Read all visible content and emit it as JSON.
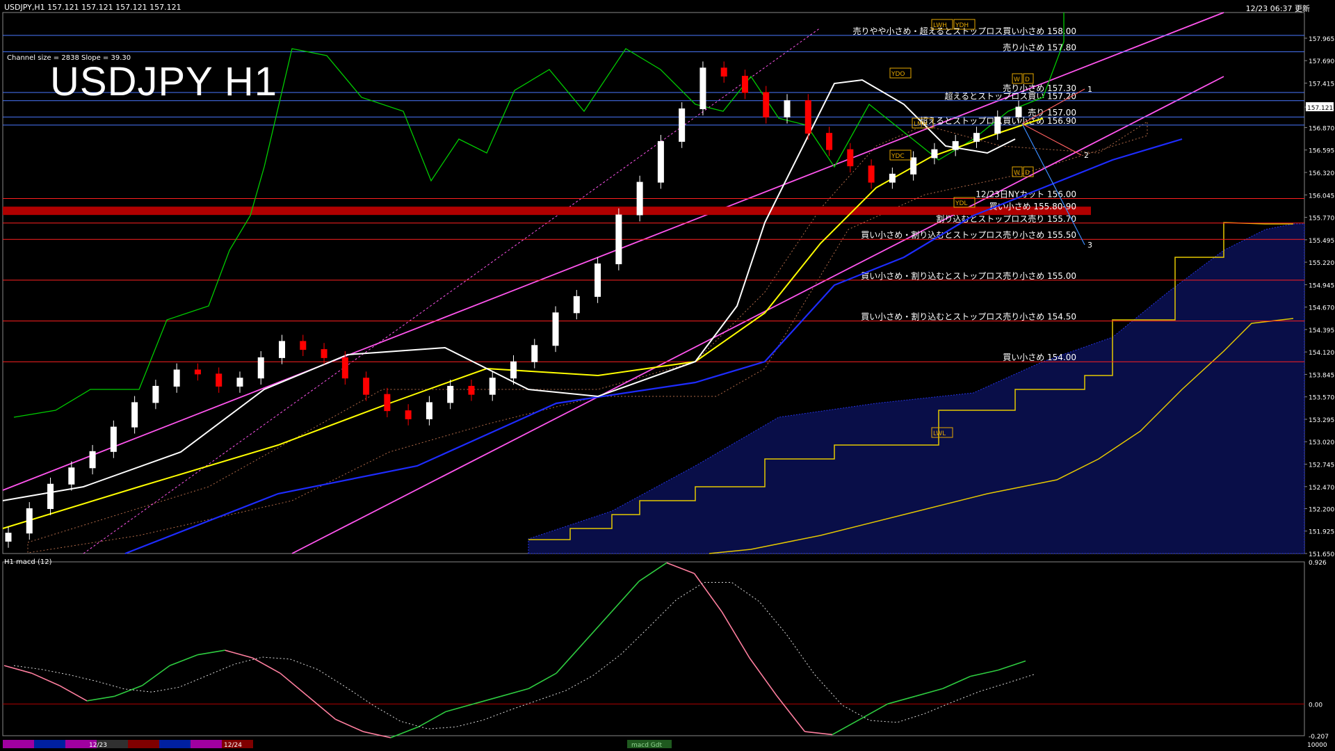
{
  "header": {
    "symbol_info": "USDJPY,H1  157.121 157.121 157.121 157.121",
    "clock": "12/23 06:37 更新",
    "big_symbol": "USDJPY H1",
    "channel_info": "Channel size = 2838 Slope = 39.30",
    "sub_label": "H1  macd (12)"
  },
  "chart_data": [
    {
      "type": "line",
      "title": "USDJPY H1",
      "ylim": [
        151.65,
        158.28
      ],
      "y_ticks": [
        "157.965",
        "157.690",
        "157.415",
        "157.121",
        "156.870",
        "156.595",
        "156.320",
        "156.045",
        "155.770",
        "155.495",
        "155.220",
        "154.945",
        "154.670",
        "154.395",
        "154.120",
        "153.845",
        "153.570",
        "153.295",
        "153.020",
        "152.745",
        "152.470",
        "152.200",
        "151.925",
        "151.650"
      ],
      "current_price": 157.121,
      "price_series": [
        151.9,
        152.2,
        152.5,
        152.7,
        152.9,
        153.2,
        153.5,
        153.7,
        153.9,
        153.85,
        153.7,
        153.8,
        154.05,
        154.25,
        154.15,
        154.05,
        153.8,
        153.6,
        153.4,
        153.3,
        153.5,
        153.7,
        153.6,
        153.8,
        154.0,
        154.2,
        154.6,
        154.8,
        155.2,
        155.8,
        156.2,
        156.7,
        157.1,
        157.6,
        157.5,
        157.3,
        157.0,
        157.2,
        156.8,
        156.6,
        156.4,
        156.2,
        156.3,
        156.5,
        156.6,
        156.7,
        156.8,
        157.0,
        157.121
      ],
      "levels": [
        {
          "price": 158.0,
          "label": "売りやや小さめ・超えるとストップロス買い小さめ 158.00",
          "color": "#4a78ff"
        },
        {
          "price": 157.8,
          "label": "売り小さめ 157.80",
          "color": "#4a78ff"
        },
        {
          "price": 157.3,
          "label": "売り小さめ 157.30",
          "color": "#4a78ff"
        },
        {
          "price": 157.2,
          "label": "超えるとストップロス買い 157.20",
          "color": "#4a78ff"
        },
        {
          "price": 157.0,
          "label": "売り 157.00",
          "color": "#4a78ff"
        },
        {
          "price": 156.9,
          "label": "超えるとストップロス買い小さめ 156.90",
          "color": "#4a78ff"
        },
        {
          "price": 156.0,
          "label": "12/23日NYカット 156.00",
          "color": "#ff2020"
        },
        {
          "price": 155.85,
          "label": "買い小さめ 155.80-90",
          "color": "#b00000"
        },
        {
          "price": 155.7,
          "label": "割り込むとストップロス売り 155.70",
          "color": "#ff2020"
        },
        {
          "price": 155.5,
          "label": "買い小さめ・割り込むとストップロス売り小さめ 155.50",
          "color": "#ff2020"
        },
        {
          "price": 155.0,
          "label": "買い小さめ・割り込むとストップロス売り小さめ 155.00",
          "color": "#ff2020"
        },
        {
          "price": 154.5,
          "label": "買い小さめ・割り込むとストップロス売り小さめ 154.50",
          "color": "#ff2020"
        },
        {
          "price": 154.0,
          "label": "買い小さめ 154.00",
          "color": "#ff2020"
        }
      ],
      "markers": [
        "LWH",
        "YDH",
        "YDO",
        "YDC",
        "YDL",
        "LMH",
        "LWL",
        "W",
        "D"
      ],
      "projection_labels": [
        "1",
        "2",
        "3"
      ],
      "colors": {
        "bull": "#ffffff",
        "bear": "#ff0000",
        "ma_fast": "#ffffff",
        "ma_mid": "#ffff00",
        "ma_slow": "#1e2cff",
        "channel": "#ff55ee",
        "chikou": "#00cc00",
        "cloud_red": "#ff9a6a",
        "cloud_blue": "#2a3aff",
        "span": "#e6c800"
      }
    },
    {
      "type": "line",
      "title": "H1  macd (12)",
      "ylim": [
        -0.207,
        0.926
      ],
      "y_ticks": [
        "0.926",
        "0.00",
        "-0.207"
      ],
      "series": [
        {
          "name": "macd (12)",
          "values": [
            0.25,
            0.2,
            0.12,
            0.02,
            0.05,
            0.12,
            0.25,
            0.32,
            0.35,
            0.3,
            0.2,
            0.05,
            -0.1,
            -0.18,
            -0.22,
            -0.15,
            -0.05,
            0.0,
            0.05,
            0.1,
            0.2,
            0.4,
            0.6,
            0.8,
            0.92,
            0.85,
            0.6,
            0.3,
            0.05,
            -0.18,
            -0.2,
            -0.1,
            0.0,
            0.05,
            0.1,
            0.18,
            0.22,
            0.28
          ]
        }
      ],
      "colors": {
        "up": "#2ecc40",
        "down": "#ff7f9f",
        "signal": "#dddddd",
        "zero": "#b00000"
      }
    }
  ],
  "date_tabs": [
    "12/23",
    "12/24"
  ],
  "status_text": "macd Gdt",
  "right_bottom": "10000"
}
